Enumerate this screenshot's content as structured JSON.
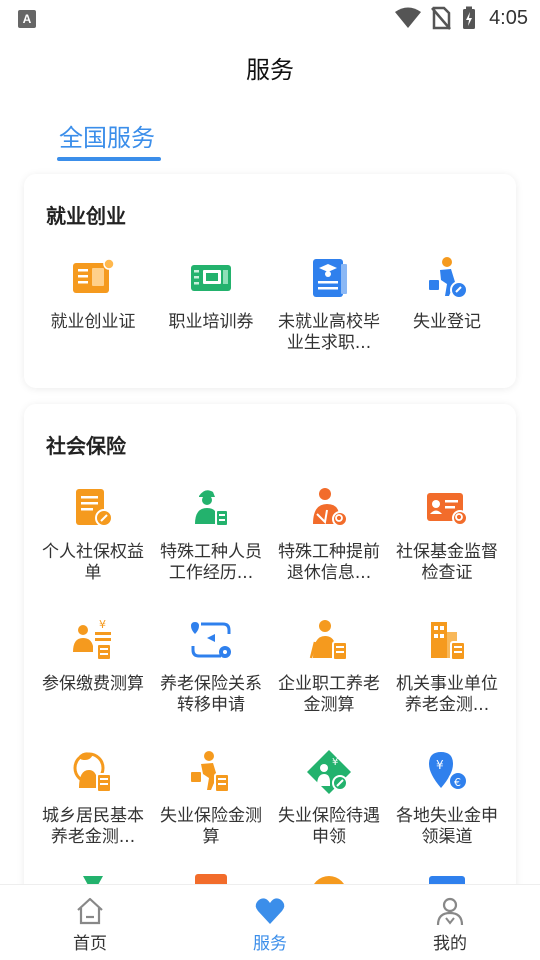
{
  "status_bar": {
    "time": "4:05",
    "left_icon": "A"
  },
  "header": {
    "title": "服务"
  },
  "tabs": [
    {
      "label": "全国服务",
      "active": true
    }
  ],
  "colors": {
    "accent": "#3b8eea",
    "orange": "#f59a1e",
    "green": "#23b26d",
    "blue": "#2f80ed"
  },
  "sections": [
    {
      "title": "就业创业",
      "items": [
        {
          "label": "就业创业证",
          "icon": "certificate-icon"
        },
        {
          "label": "职业培训券",
          "icon": "training-ticket-icon"
        },
        {
          "label": "未就业高校毕业生求职...",
          "icon": "graduate-icon"
        },
        {
          "label": "失业登记",
          "icon": "unemployment-register-icon"
        }
      ]
    },
    {
      "title": "社会保险",
      "items": [
        {
          "label": "个人社保权益单",
          "icon": "document-icon"
        },
        {
          "label": "特殊工种人员工作经历...",
          "icon": "worker-icon"
        },
        {
          "label": "特殊工种提前退休信息...",
          "icon": "worker-search-icon"
        },
        {
          "label": "社保基金监督检查证",
          "icon": "id-card-icon"
        },
        {
          "label": "参保缴费测算",
          "icon": "payment-calc-icon"
        },
        {
          "label": "养老保险关系转移申请",
          "icon": "transfer-icon"
        },
        {
          "label": "企业职工养老金测算",
          "icon": "elder-calc-icon"
        },
        {
          "label": "机关事业单位养老金测...",
          "icon": "building-calc-icon"
        },
        {
          "label": "城乡居民基本养老金测...",
          "icon": "resident-calc-icon"
        },
        {
          "label": "失业保险金测算",
          "icon": "unemployment-calc-icon"
        },
        {
          "label": "失业保险待遇申领",
          "icon": "benefit-claim-icon"
        },
        {
          "label": "各地失业金申领渠道",
          "icon": "location-money-icon"
        }
      ]
    }
  ],
  "bottom_nav": [
    {
      "label": "首页",
      "icon": "home-icon"
    },
    {
      "label": "服务",
      "icon": "heart-icon",
      "active": true
    },
    {
      "label": "我的",
      "icon": "profile-icon"
    }
  ]
}
